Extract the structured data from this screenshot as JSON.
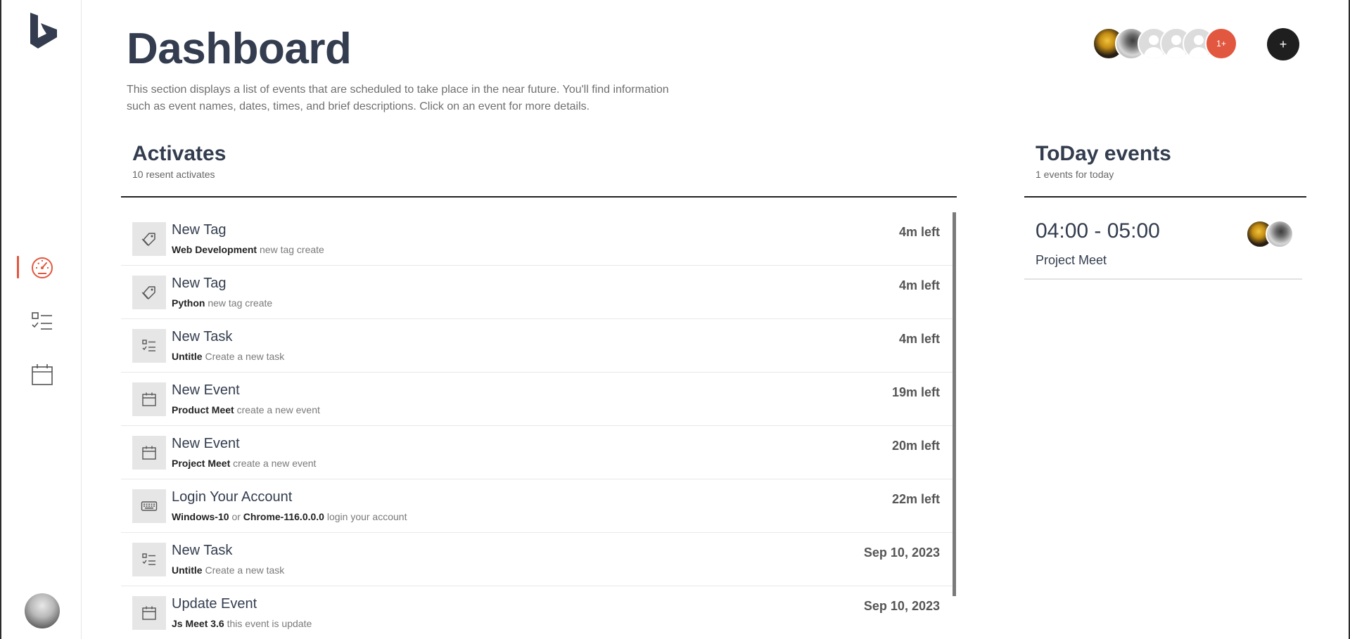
{
  "header": {
    "title": "Dashboard",
    "description": "This section displays a list of events that are scheduled to take place in the near future. You'll find information such as event names, dates, times, and brief descriptions. Click on an event for more details.",
    "more_avatars_label": "1+",
    "add_label": "+"
  },
  "activates": {
    "title": "Activates",
    "subtitle": "10 resent activates",
    "items": [
      {
        "icon": "tag-icon",
        "title": "New Tag",
        "bold": "Web Development",
        "text": "new tag create",
        "time": "4m left"
      },
      {
        "icon": "tag-icon",
        "title": "New Tag",
        "bold": "Python",
        "text": "new tag create",
        "time": "4m left"
      },
      {
        "icon": "task-list-icon",
        "title": "New Task",
        "bold": "Untitle",
        "text": "Create a new task",
        "time": "4m left"
      },
      {
        "icon": "calendar-icon",
        "title": "New Event",
        "bold": "Product Meet",
        "text": "create a new event",
        "time": "19m left"
      },
      {
        "icon": "calendar-icon",
        "title": "New Event",
        "bold": "Project Meet",
        "text": "create a new event",
        "time": "20m left"
      },
      {
        "icon": "keyboard-icon",
        "title": "Login Your Account",
        "bold": "Windows-10",
        "connector": "or",
        "bold2": "Chrome-116.0.0.0",
        "text": "login your account",
        "time": "22m left"
      },
      {
        "icon": "task-list-icon",
        "title": "New Task",
        "bold": "Untitle",
        "text": "Create a new task",
        "time": "Sep 10, 2023"
      },
      {
        "icon": "calendar-icon",
        "title": "Update Event",
        "bold": "Js Meet 3.6",
        "text": "this event is update",
        "time": "Sep 10, 2023"
      }
    ]
  },
  "today": {
    "title": "ToDay events",
    "subtitle": "1 events for today",
    "events": [
      {
        "time": "04:00 - 05:00",
        "name": "Project Meet"
      }
    ]
  },
  "colors": {
    "accent": "#e2573f",
    "text_dark": "#333d4f",
    "muted": "#6f6f6f",
    "icon_bg": "#e6e6e6"
  }
}
